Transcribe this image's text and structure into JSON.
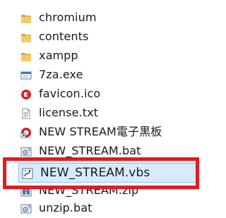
{
  "explorer": {
    "files": [
      {
        "name": "chromium",
        "icon": "folder-icon",
        "selected": false
      },
      {
        "name": "contents",
        "icon": "folder-icon",
        "selected": false
      },
      {
        "name": "xampp",
        "icon": "folder-icon",
        "selected": false
      },
      {
        "name": "7za.exe",
        "icon": "exe-window-icon",
        "selected": false
      },
      {
        "name": "favicon.ico",
        "icon": "ico-red-icon",
        "selected": false
      },
      {
        "name": "license.txt",
        "icon": "text-file-icon",
        "selected": false
      },
      {
        "name": "NEW STREAM電子黒板",
        "icon": "shortcut-app-icon",
        "selected": false
      },
      {
        "name": "NEW_STREAM.bat",
        "icon": "batch-file-icon",
        "selected": false
      },
      {
        "name": "NEW_STREAM.vbs",
        "icon": "vbs-script-icon",
        "selected": true
      },
      {
        "name": "NEW_STREAM.zip",
        "icon": "zip-file-icon",
        "selected": false
      },
      {
        "name": "unzip.bat",
        "icon": "batch-file-icon",
        "selected": false
      }
    ]
  },
  "colors": {
    "highlight_border": "#e11b22",
    "selection_fill": "#d7ebff",
    "selection_border": "#8cc7ff",
    "folder": "#e8b84c"
  }
}
